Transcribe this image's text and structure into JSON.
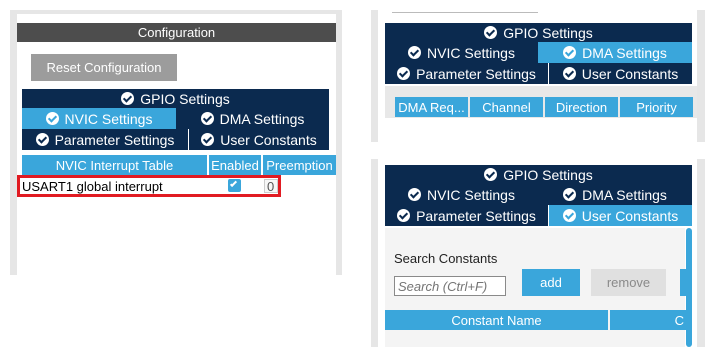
{
  "left": {
    "config_title": "Configuration",
    "reset_button": "Reset Configuration",
    "tabs": {
      "gpio": "GPIO Settings",
      "nvic": "NVIC Settings",
      "dma": "DMA Settings",
      "parameter": "Parameter Settings",
      "user_constants": "User Constants"
    },
    "table": {
      "headers": [
        "NVIC Interrupt Table",
        "Enabled",
        "Preemption"
      ],
      "rows": [
        {
          "name": "USART1 global interrupt",
          "enabled": true,
          "priority": "0"
        }
      ]
    }
  },
  "top_right": {
    "tabs": {
      "gpio": "GPIO Settings",
      "nvic": "NVIC Settings",
      "dma": "DMA Settings",
      "parameter": "Parameter Settings",
      "user_constants": "User Constants"
    },
    "dma_headers": [
      "DMA Req...",
      "Channel",
      "Direction",
      "Priority"
    ]
  },
  "bottom_right": {
    "tabs": {
      "gpio": "GPIO Settings",
      "nvic": "NVIC Settings",
      "dma": "DMA Settings",
      "parameter": "Parameter Settings",
      "user_constants": "User Constants"
    },
    "search_label": "Search Constants",
    "search_placeholder": "Search (Ctrl+F)",
    "add_button": "add",
    "remove_button": "remove",
    "table_headers": [
      "Constant Name",
      "C"
    ]
  },
  "colors": {
    "navy": "#0b2a4f",
    "blue": "#3aa6db",
    "highlight": "#e11b22"
  }
}
